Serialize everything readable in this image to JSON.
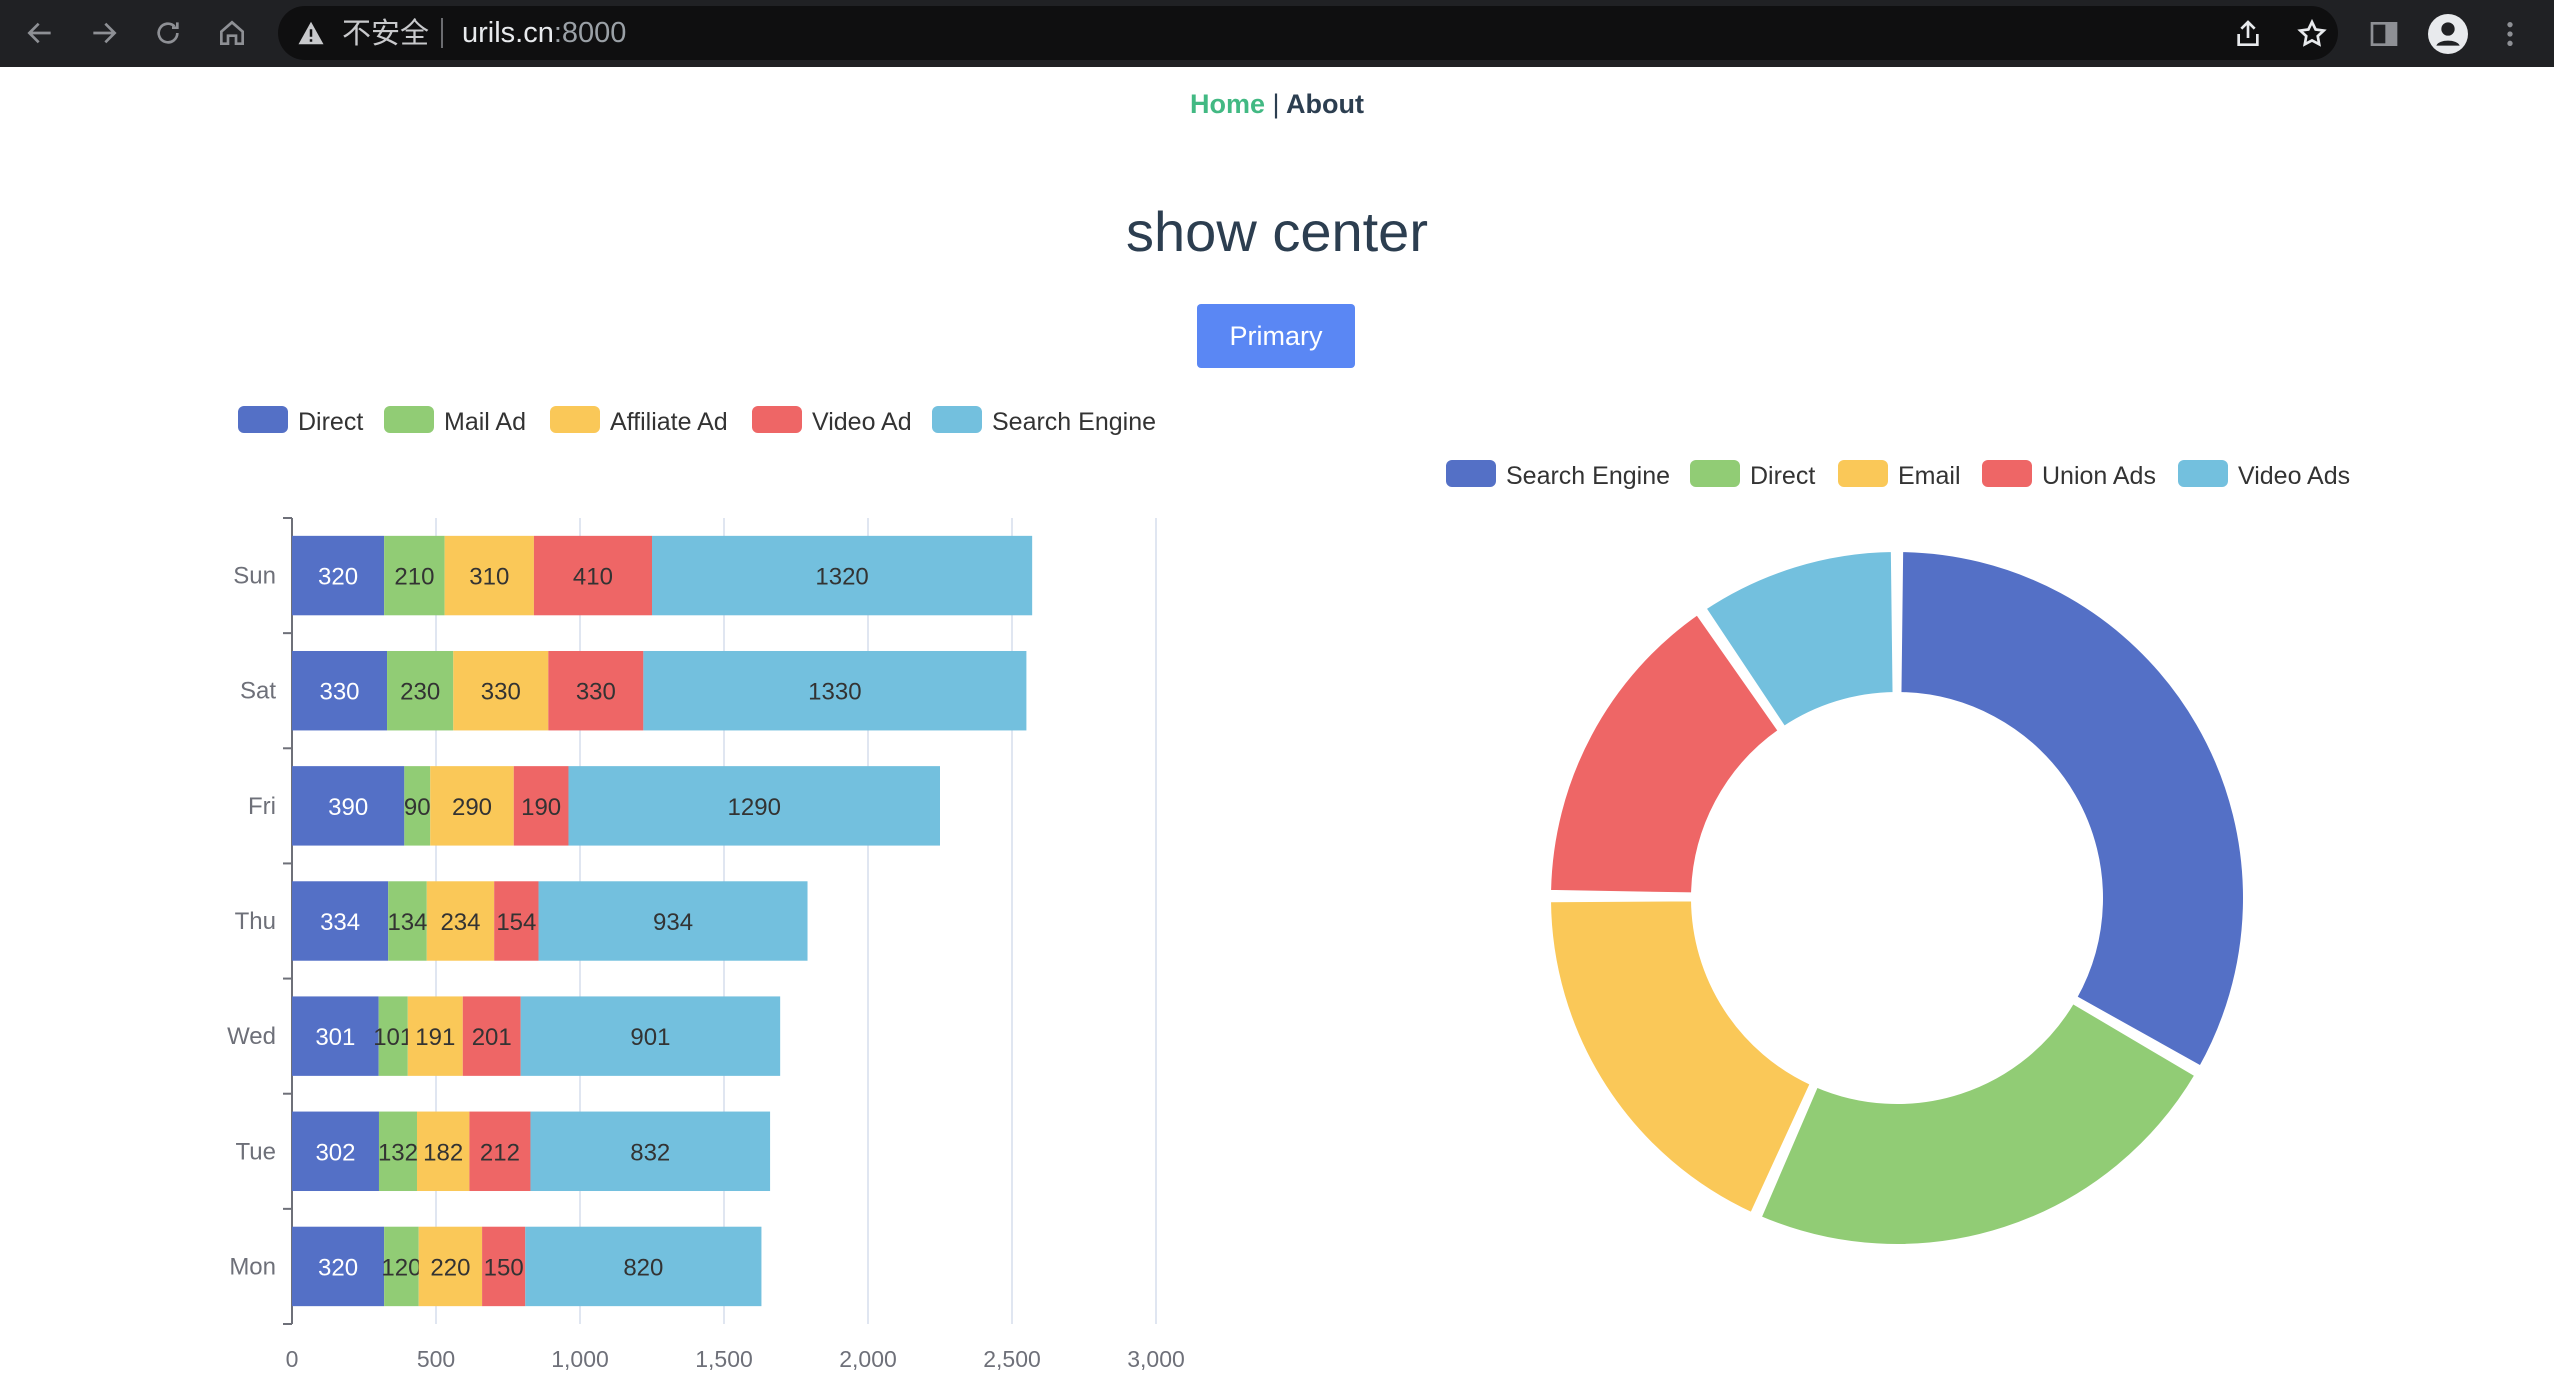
{
  "browser": {
    "security_label": "不安全",
    "url_host": "urils.cn",
    "url_port": ":8000",
    "icons": [
      "back-icon",
      "forward-icon",
      "reload-icon",
      "home-icon",
      "warning-icon",
      "share-icon",
      "bookmark-star-icon",
      "side-panel-icon",
      "profile-icon",
      "menu-icon"
    ]
  },
  "nav": {
    "home": "Home",
    "divider": "|",
    "about": "About"
  },
  "page": {
    "title": "show center",
    "button_label": "Primary"
  },
  "chart_data": [
    {
      "type": "bar",
      "orientation": "horizontal",
      "stacked": true,
      "categories": [
        "Mon",
        "Tue",
        "Wed",
        "Thu",
        "Fri",
        "Sat",
        "Sun"
      ],
      "series": [
        {
          "name": "Direct",
          "color": "#5470c6",
          "values": [
            320,
            302,
            301,
            334,
            390,
            330,
            320
          ]
        },
        {
          "name": "Mail Ad",
          "color": "#91cc75",
          "values": [
            120,
            132,
            101,
            134,
            90,
            230,
            210
          ]
        },
        {
          "name": "Affiliate Ad",
          "color": "#fac858",
          "values": [
            220,
            182,
            191,
            234,
            290,
            330,
            310
          ]
        },
        {
          "name": "Video Ad",
          "color": "#ee6666",
          "values": [
            150,
            212,
            201,
            154,
            190,
            330,
            410
          ]
        },
        {
          "name": "Search Engine",
          "color": "#73c0de",
          "values": [
            820,
            832,
            901,
            934,
            1290,
            1330,
            1320
          ]
        }
      ],
      "x_ticks": [
        "0",
        "500",
        "1,000",
        "1,500",
        "2,000",
        "2,500",
        "3,000"
      ],
      "xlim": [
        0,
        3000
      ],
      "legend": "top-left",
      "grid": true
    },
    {
      "type": "pie",
      "variant": "donut",
      "slices": [
        {
          "name": "Search Engine",
          "value": 1048,
          "color": "#5470c6"
        },
        {
          "name": "Direct",
          "value": 735,
          "color": "#91cc75"
        },
        {
          "name": "Email",
          "value": 580,
          "color": "#fac858"
        },
        {
          "name": "Union Ads",
          "value": 484,
          "color": "#ee6666"
        },
        {
          "name": "Video Ads",
          "value": 300,
          "color": "#73c0de"
        }
      ],
      "legend": "top-center"
    }
  ]
}
